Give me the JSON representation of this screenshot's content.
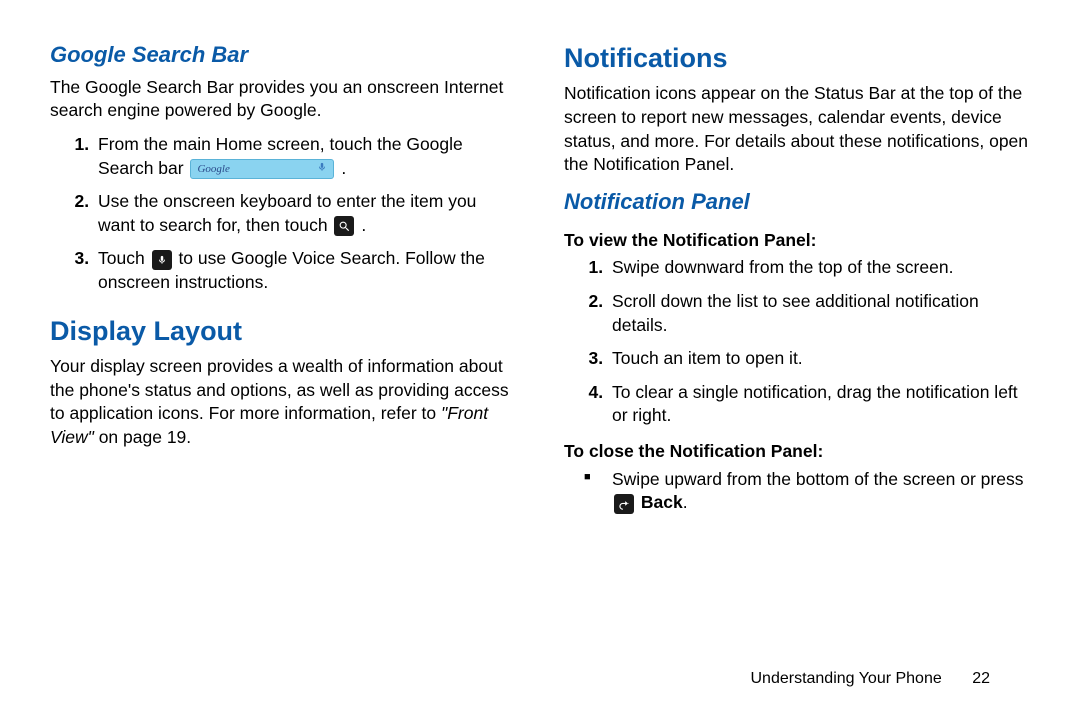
{
  "left": {
    "h1": "Google Search Bar",
    "intro": "The Google Search Bar provides you an onscreen Internet search engine powered by Google.",
    "step1_a": "From the main Home screen, touch the Google Search bar ",
    "step1_b": ".",
    "search_label": "Google",
    "step2_a": "Use the onscreen keyboard to enter the item you want to search for, then touch ",
    "step2_b": ".",
    "step3_a": "Touch ",
    "step3_b": " to use Google Voice Search. Follow the onscreen instructions.",
    "h2": "Display Layout",
    "dl_a": "Your display screen provides a wealth of information about the phone's status and options, as well as providing access to application icons. For more information, refer to ",
    "dl_ref": "\"Front View\"",
    "dl_b": " on page 19."
  },
  "right": {
    "h1": "Notifications",
    "intro": "Notification icons appear on the Status Bar at the top of the screen to report new messages, calendar events, device status, and more. For details about these notifications, open the Notification Panel.",
    "h2": "Notification Panel",
    "sub1": "To view the Notification Panel:",
    "v1": "Swipe downward from the top of the screen.",
    "v2": "Scroll down the list to see additional notification details.",
    "v3": "Touch an item to open it.",
    "v4": "To clear a single notification, drag the notification left or right.",
    "sub2": "To close the Notification Panel:",
    "c1_a": "Swipe upward from the bottom of the screen or press ",
    "c1_back": " Back",
    "c1_b": "."
  },
  "footer": {
    "section": "Understanding Your Phone",
    "page": "22"
  }
}
